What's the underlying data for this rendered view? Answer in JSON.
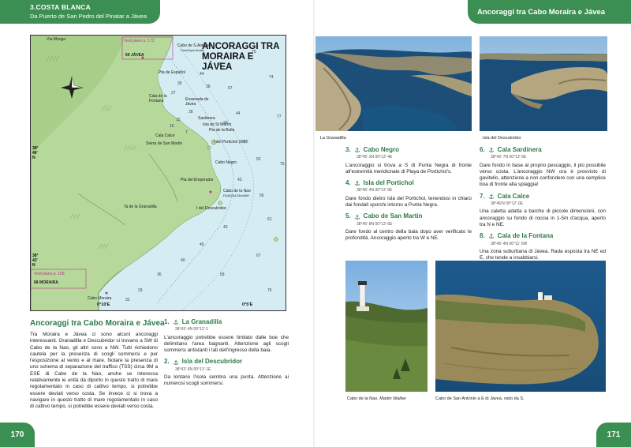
{
  "header": {
    "chapter": "3.COSTA BLANCA",
    "subtitle": "Da Puerto de San Pedro del Pinatar a Jávea",
    "right_title": "Ancoraggi tra Cabo Moraira e Jávea"
  },
  "page_numbers": {
    "left": "170",
    "right": "171"
  },
  "map": {
    "title_line1": "ANCORAGGI TRA",
    "title_line2": "MORAIRA E JÁVEA",
    "labels": {
      "via_mongo": "Vía Mongo",
      "vedi_top": "Vedi piano p. 172",
      "cabo_san_antonio": "Cabo de S.Antonio",
      "cabo_san_antonio_sub": "Faro/Hydr.Nordic",
      "jav": "69 JÁVEA",
      "playa_espanol": "Pta de Español",
      "ensenada": "Ensenada de Jávea",
      "cala_fontana": "Cala de la Fontana",
      "sardinera": "Sardinera",
      "isla_st_martin": "Isla de St Martín",
      "pta_bulla": "Pta de la Bulla",
      "isla_portichol": "I del Portichol (68)",
      "cala_calce": "Cala Calce",
      "sierra": "Sierra de San Martín",
      "cabo_negro": "Cabo Negro",
      "pta_emperador": "Pta del Emperador",
      "cabo_nao": "Cabo de la Nao",
      "cabo_nao_sub": "Fl(4)20s123m40M",
      "granadilla": "Ta de la Granadilla",
      "descubridor": "I del Descubridor",
      "vedi_bottom": "Vedi piano p. 168",
      "moraira": "68 MORAIRA",
      "cabo_moraira": "Cabo Moraira",
      "lon": "0°10'E",
      "lon2": "0°5'E",
      "lat1": "38°\n46'\nN",
      "lat2": "38°\n42'\nN"
    },
    "depths": [
      "75",
      "80",
      "74",
      "67",
      "44",
      "38",
      "35",
      "27",
      "28",
      "12",
      "16",
      "44",
      "26",
      "45",
      "52",
      "43",
      "56",
      "61",
      "77",
      "67",
      "76",
      "43",
      "45",
      "40",
      "58",
      "36",
      "33",
      "75",
      "7",
      "32"
    ]
  },
  "left_section": {
    "heading": "Ancoraggi tra Cabo Moraira e Jávea",
    "intro": "Tra Moraira e Jávea ci sono alcuni ancoraggi interessanti. Granadilla e Descubridor si trovano a SW di Cabo de la Nao, gli altri sono a NW. Tutti richiedono cautela per la presenza di scogli sommersi e per l'esposizione al vento e al mare. Notare la presenza di uno schema di separazione del traffico (TSS) circa 9M a ESE di Cabo de la Nao, anche se interessa relativamente le unità da diporto in questo tratto di mare regolamentato in caso di cattivo tempo, si potrebbe essere deviati verso costa. Se invece ci si trova a navigare in questo tratto di mare regolamentato in caso di cattivo tempo, si potrebbe essere deviati verso costa."
  },
  "entries": [
    {
      "num": "1.",
      "name": "La Granadilla",
      "coord": "38°43'·4N 00°12'·1",
      "text": "L'ancoraggio potrebbe essere limitato dalle boe che delimitano l'area bagnanti. Attenzione agli scogli sommersi antistanti i lati dell'ingresso della baia."
    },
    {
      "num": "2.",
      "name": "Isla del Descubridor",
      "coord": "38°43'·6N 00°13'·1E",
      "text": "Da lontano l'isola sembra una punta. Attenzione ai numerosi scogli sommersi."
    },
    {
      "num": "3.",
      "name": "Cabo Negro",
      "coord": "38°45'·2N 00°13'·4E",
      "text": "L'ancoraggio si trova a S di Punta Negra di fronte all'estremità meridionale di Playa de Portichol's."
    },
    {
      "num": "4.",
      "name": "Isla del Portichol",
      "coord": "38°45'·4N 00°13'·9E",
      "text": "Dare fondo dietro Isla del Portichol, tenendosi in chiaro dai fondali sporchi intorno a Punta Negra."
    },
    {
      "num": "5.",
      "name": "Cabo de San Martín",
      "coord": "38°45'·8N 00°13'·6E",
      "text": "Dare fondo al centro della baia dopo aver verificato le profondità. Ancoraggio aperto tra W e NE."
    },
    {
      "num": "6.",
      "name": "Cala Sardinera",
      "coord": "38°45'·7N 00°13'·5E",
      "text": "Dare fondo in base al proprio pescaggio, il più possibile verso costa. L'ancoraggio NW ora è provvisto di gavitello, attenzione a non confondere con una semplice boa di fronte alla spiaggia!"
    },
    {
      "num": "7.",
      "name": "Cala Calce",
      "coord": "38°46'N 00°12'·0E",
      "text": "Una caletta adatta a barche di piccole dimensioni, con ancoraggio su fondo di roccia in 1-5m d'acqua, aperto tra N e NE."
    },
    {
      "num": "8.",
      "name": "Cala de la Fontana",
      "coord": "38°46'·4N 00°11'·5W",
      "text": "Una zona suburbana di Jávea. Rada esposta tra NE ed E, che tende a insabbiarsi."
    }
  ],
  "captions": {
    "granadilla": "La Granadilla",
    "descubridor": "Isla del Descubridor",
    "nao": "Cabo de la Nao.",
    "nao_author": "Martin Walker",
    "san_antonio": "Cabo de San Antonio a E di Jávea, visto da S."
  },
  "colors": {
    "accent": "#3c8f52",
    "heading": "#2e7a48",
    "land": "#a8cf8a",
    "sea": "#cfe8f0"
  }
}
